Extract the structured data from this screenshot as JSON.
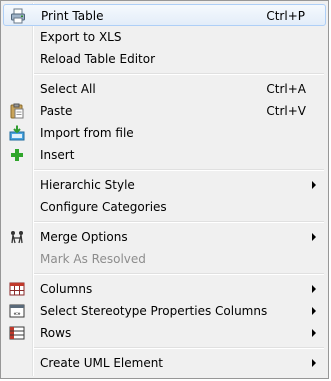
{
  "menu": {
    "print_table": {
      "label": "Print Table",
      "shortcut": "Ctrl+P",
      "icon": "printer-icon"
    },
    "export_xls": {
      "label": "Export to XLS"
    },
    "reload_table_editor": {
      "label": "Reload Table Editor"
    },
    "select_all": {
      "label": "Select All",
      "shortcut": "Ctrl+A"
    },
    "paste": {
      "label": "Paste",
      "shortcut": "Ctrl+V",
      "icon": "clipboard-icon"
    },
    "import_from_file": {
      "label": "Import from file",
      "icon": "import-icon"
    },
    "insert": {
      "label": "Insert",
      "icon": "plus-icon"
    },
    "hierarchic_style": {
      "label": "Hierarchic Style"
    },
    "configure_categories": {
      "label": "Configure Categories"
    },
    "merge_options": {
      "label": "Merge Options",
      "icon": "merge-icon"
    },
    "mark_as_resolved": {
      "label": "Mark As Resolved"
    },
    "columns": {
      "label": "Columns",
      "icon": "table-columns-icon"
    },
    "select_stereotype_properties_columns": {
      "label": "Select Stereotype Properties Columns",
      "icon": "stereotype-table-icon"
    },
    "rows": {
      "label": "Rows",
      "icon": "table-rows-icon"
    },
    "create_uml_element": {
      "label": "Create UML Element"
    }
  },
  "colors": {
    "highlight_border": "#aecff7",
    "disabled_text": "#8d8d8d",
    "plus_green": "#2fa52b"
  }
}
